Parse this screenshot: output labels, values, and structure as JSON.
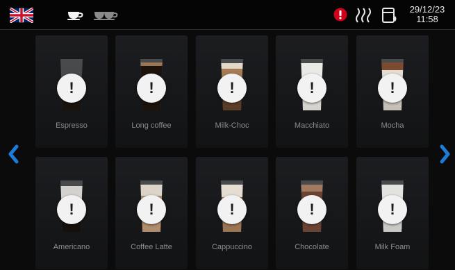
{
  "status_bar": {
    "language_icon": "uk-flag-icon",
    "cup_icons": [
      "single-cup-icon",
      "double-cup-icon"
    ],
    "alert_icon": "warning-icon",
    "alert_color": "#d0021b",
    "heating_icon": "heating-icon",
    "bin_icon": "waste-bin-icon",
    "date": "29/12/23",
    "time": "11:58"
  },
  "products": [
    {
      "label": "Espresso",
      "glass": "espresso"
    },
    {
      "label": "Long coffee",
      "glass": "long-coffee"
    },
    {
      "label": "Milk-Choc",
      "glass": "milk-choc"
    },
    {
      "label": "Macchiato",
      "glass": "macchiato"
    },
    {
      "label": "Mocha",
      "glass": "mocha"
    },
    {
      "label": "Americano",
      "glass": "americano"
    },
    {
      "label": "Coffee Latte",
      "glass": "coffee-latte"
    },
    {
      "label": "Cappuccino",
      "glass": "cappuccino"
    },
    {
      "label": "Chocolate",
      "glass": "chocolate"
    },
    {
      "label": "Milk Foam",
      "glass": "milk-foam"
    }
  ],
  "tile_status_icon": "warning-icon",
  "tile_status_symbol": "!",
  "navigation": {
    "prev_icon": "chevron-left-icon",
    "next_icon": "chevron-right-icon",
    "accent": "#1e7bd8"
  }
}
